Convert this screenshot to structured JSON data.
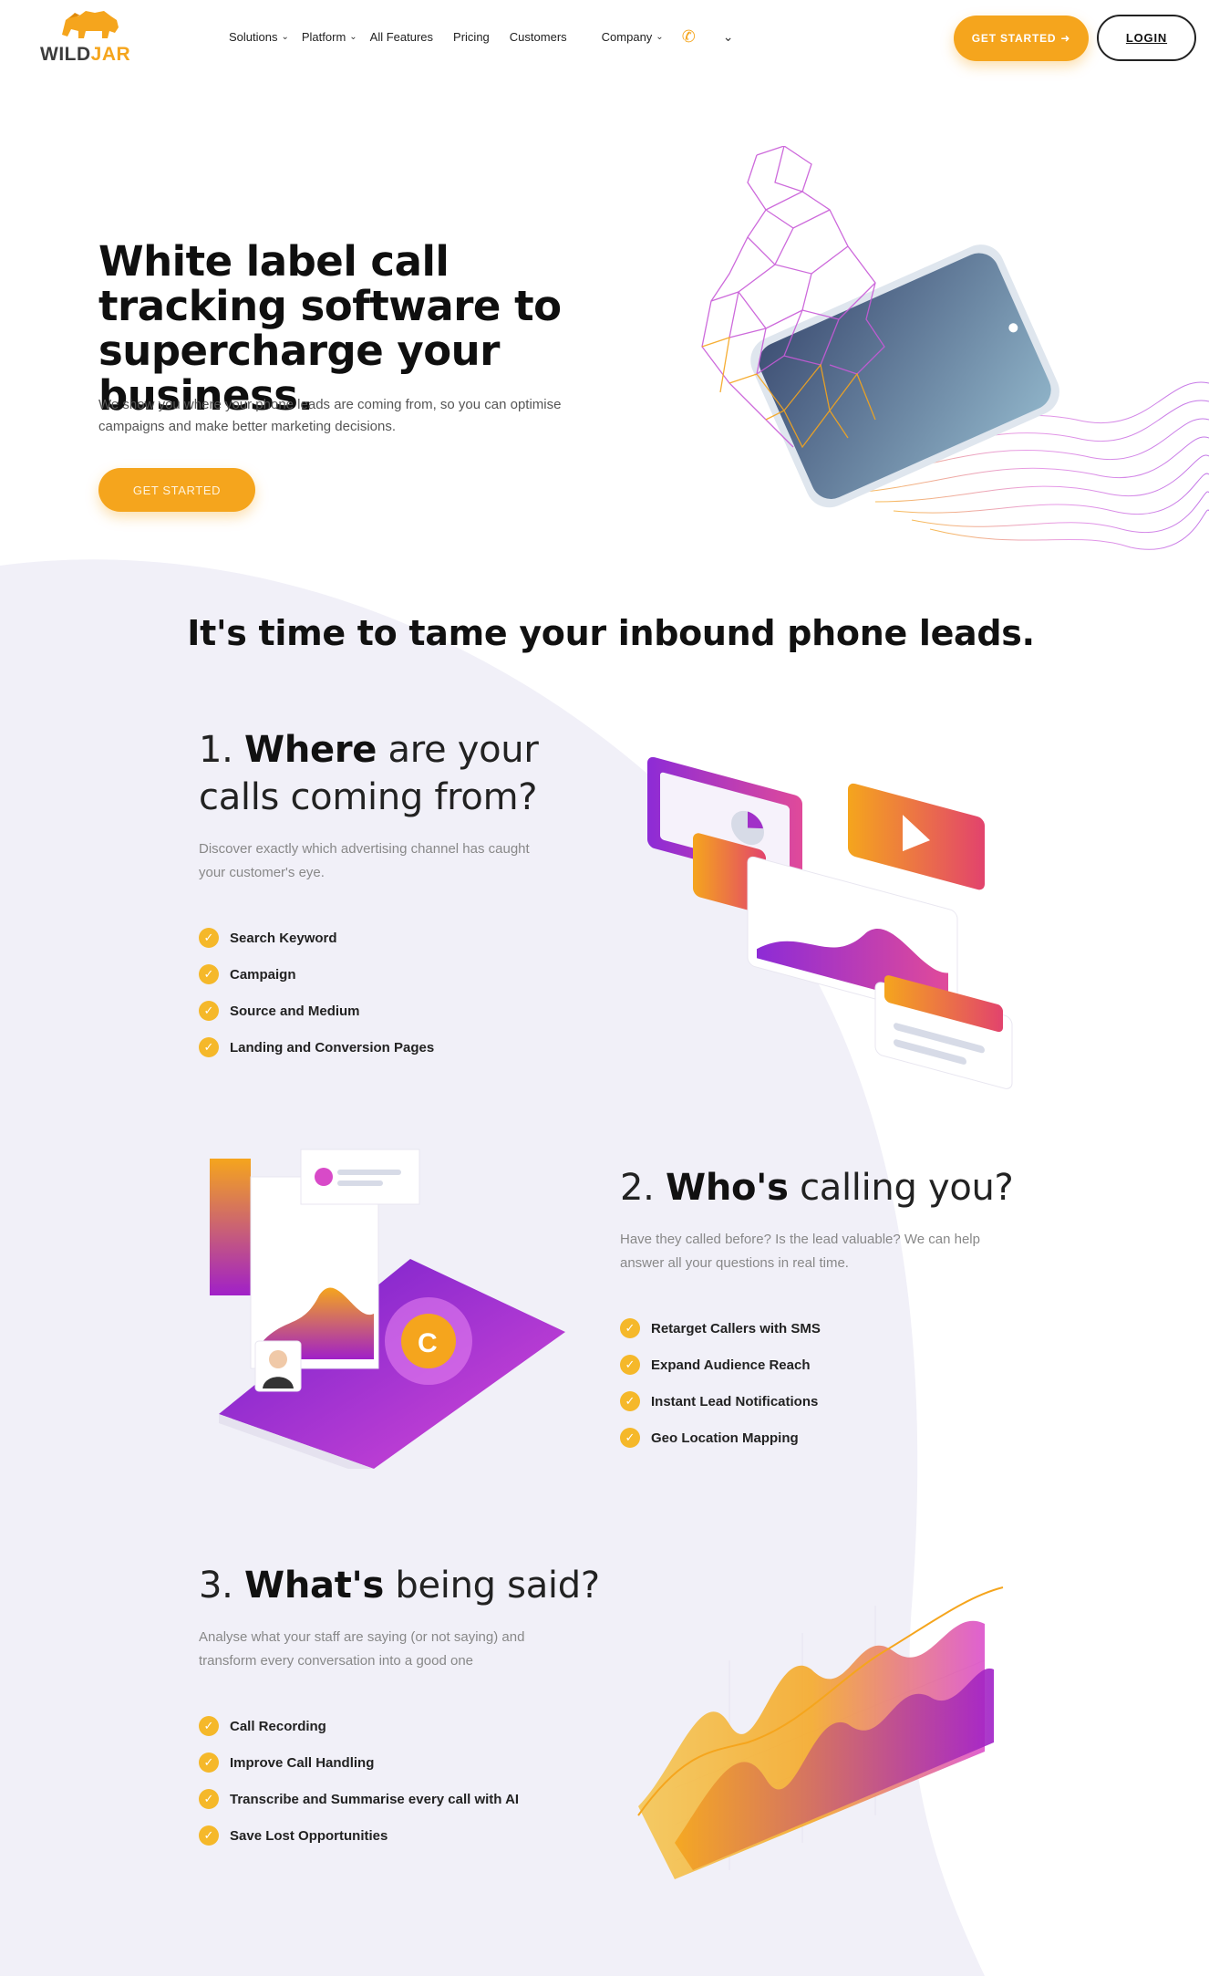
{
  "brand": {
    "name_part1": "WILD",
    "name_part2": "JAR",
    "accent_color": "#f5a51d",
    "purple_color": "#a020c8"
  },
  "nav": {
    "items": [
      {
        "label": "Solutions",
        "has_dropdown": true
      },
      {
        "label": "Platform",
        "has_dropdown": true
      },
      {
        "label": "All Features",
        "has_dropdown": false
      },
      {
        "label": "Pricing",
        "has_dropdown": false
      },
      {
        "label": "Customers",
        "has_dropdown": false
      },
      {
        "label": "Company",
        "has_dropdown": true
      }
    ],
    "phone_icon": "phone-icon",
    "more_icon": "chevron-down-icon",
    "get_started_label": "GET STARTED",
    "login_label": "LOGIN"
  },
  "hero": {
    "title": "White label call tracking software to supercharge your business.",
    "subtitle": "We show you where your phone leads are coming from, so you can optimise campaigns and make better marketing decisions.",
    "cta_label": "GET STARTED"
  },
  "section": {
    "heading": "It's time to tame your inbound phone leads."
  },
  "features": [
    {
      "number": "1.",
      "title_bold": "Where",
      "title_rest": "are your calls coming from?",
      "description": "Discover exactly which advertising channel has caught your customer's eye.",
      "items": [
        "Search Keyword",
        "Campaign",
        "Source and Medium",
        "Landing and Conversion Pages"
      ]
    },
    {
      "number": "2.",
      "title_bold": "Who's",
      "title_rest": "calling you?",
      "description": "Have they called before? Is the lead valuable? We can help answer all your questions in real time.",
      "items": [
        "Retarget Callers with SMS",
        "Expand Audience Reach",
        "Instant Lead Notifications",
        "Geo Location Mapping"
      ]
    },
    {
      "number": "3.",
      "title_bold": "What's",
      "title_rest": "being said?",
      "description": "Analyse what your staff are saying (or not saying) and transform every conversation into a good one",
      "items": [
        "Call Recording",
        "Improve Call Handling",
        "Transcribe and Summarise every call with AI",
        "Save Lost Opportunities"
      ]
    }
  ]
}
